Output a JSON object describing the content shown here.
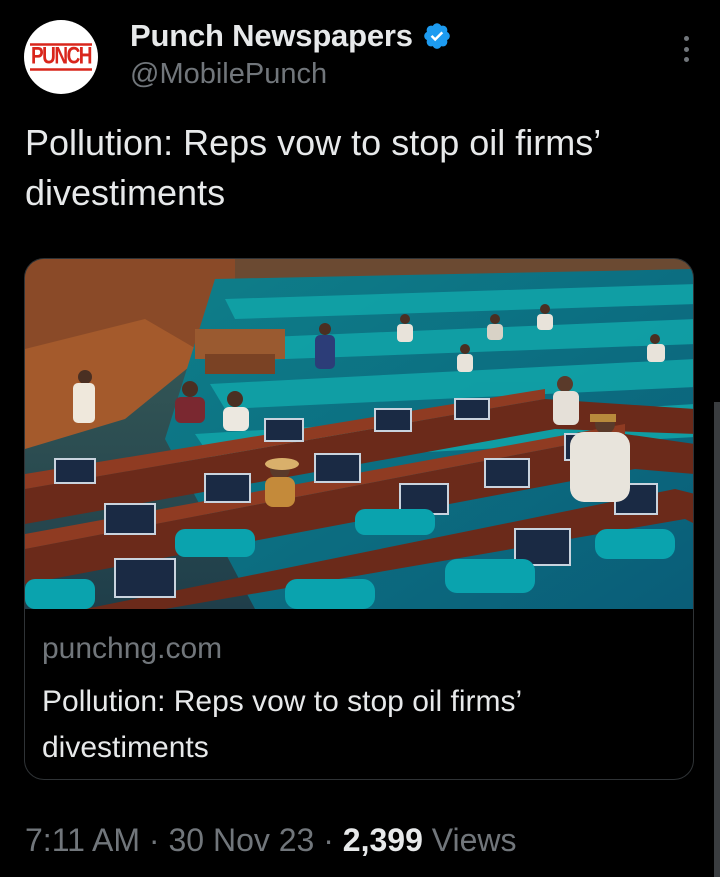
{
  "author": {
    "display_name": "Punch Newspapers",
    "handle": "@MobilePunch",
    "avatar_text": "PUNCH",
    "verified": true
  },
  "tweet": {
    "text": "Pollution: Reps vow to stop oil firms’ divestiments"
  },
  "card": {
    "domain": "punchng.com",
    "title": "Pollution: Reps vow to stop oil firms’ divestiments"
  },
  "meta": {
    "time": "7:11 AM",
    "separator": "·",
    "date": "30 Nov 23",
    "views_count": "2,399",
    "views_label": "Views"
  },
  "colors": {
    "background": "#000000",
    "primary_text": "#e7e9ea",
    "secondary_text": "#71767b",
    "verified_blue": "#1d9bf0",
    "card_border": "#2f3336",
    "brand_red": "#d9261c"
  },
  "icons": {
    "verified": "verified-badge-icon",
    "more": "more-options-icon"
  }
}
